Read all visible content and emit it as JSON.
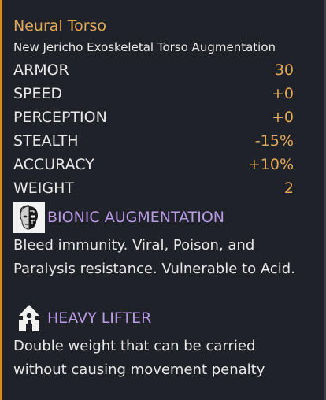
{
  "item": {
    "name": "Neural Torso",
    "subtitle": "New Jericho Exoskeletal Torso Augmentation"
  },
  "stats": [
    {
      "label": "ARMOR",
      "value": "30"
    },
    {
      "label": "SPEED",
      "value": "+0"
    },
    {
      "label": "PERCEPTION",
      "value": "+0"
    },
    {
      "label": "STEALTH",
      "value": "-15%"
    },
    {
      "label": "ACCURACY",
      "value": "+10%"
    },
    {
      "label": "WEIGHT",
      "value": "2"
    }
  ],
  "perks": [
    {
      "icon": "bionic-head-icon",
      "title": "BIONIC AUGMENTATION",
      "description": "Bleed immunity. Viral, Poison, and Paralysis resistance. Vulnerable to Acid."
    },
    {
      "icon": "heavy-lifter-icon",
      "title": "HEAVY LIFTER",
      "description": "Double weight that can be carried without causing movement penalty"
    }
  ],
  "colors": {
    "background": "#1f2229",
    "accent_border": "#d68a22",
    "title": "#e4a95a",
    "stat_value": "#e4a95a",
    "perk_title": "#b99be6",
    "text": "#e8e8e8"
  }
}
